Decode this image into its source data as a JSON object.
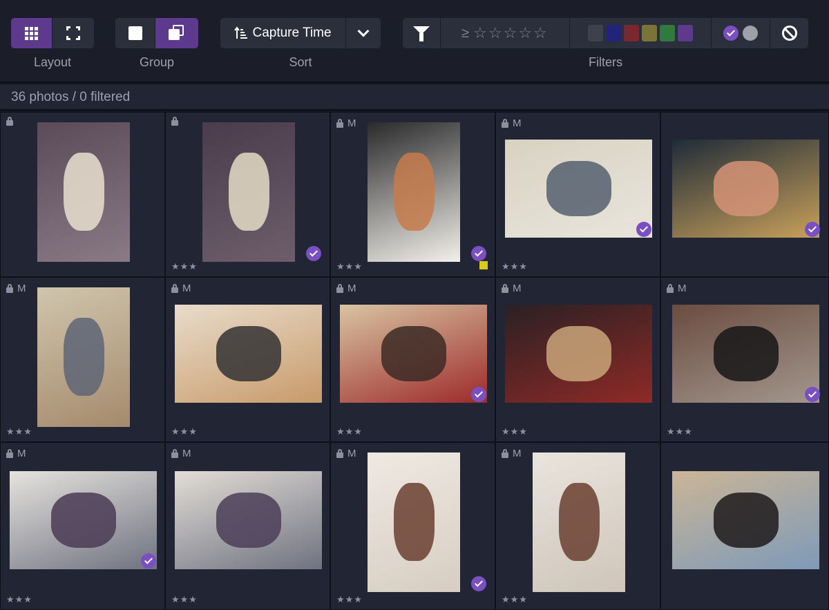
{
  "toolbar": {
    "layout": {
      "label": "Layout",
      "options": [
        "grid-icon",
        "expand-icon"
      ],
      "active": 0
    },
    "group": {
      "label": "Group",
      "options": [
        "single-square-icon",
        "stacked-squares-icon"
      ],
      "active": 1
    },
    "sort": {
      "label": "Sort",
      "value": "Capture Time",
      "icon": "sort-ascending-icon"
    },
    "filters": {
      "label": "Filters",
      "rating_operator": "≥",
      "rating_value": 0,
      "stars_max": 5,
      "color_swatches": [
        "#3d414c",
        "#23237a",
        "#7a2830",
        "#7a7438",
        "#2f7a3c",
        "#5d3a8e"
      ],
      "pick_states": [
        "picked",
        "unpicked"
      ],
      "reject_icon": "no-entry-icon"
    },
    "colors": {
      "active": "#5d3a8e",
      "button": "#2b2f3c",
      "check": "#7a4fc2"
    }
  },
  "status": {
    "text": "36 photos / 0 filtered"
  },
  "photos": [
    {
      "locked": true,
      "mode": "",
      "stars": "",
      "picked": false,
      "label": "",
      "subject": "bouquet-1",
      "orientation": "portrait"
    },
    {
      "locked": true,
      "mode": "",
      "stars": "★★★",
      "picked": true,
      "label": "",
      "subject": "bouquet-2",
      "orientation": "portrait"
    },
    {
      "locked": true,
      "mode": "M",
      "stars": "★★★",
      "picked": true,
      "label": "yellow",
      "subject": "groom-tuxedo",
      "orientation": "portrait"
    },
    {
      "locked": true,
      "mode": "M",
      "stars": "★★★",
      "picked": true,
      "label": "",
      "subject": "bridesmaids-pajamas",
      "orientation": "landscape"
    },
    {
      "locked": false,
      "mode": "",
      "stars": "",
      "picked": true,
      "label": "",
      "subject": "watch-hands",
      "orientation": "landscape"
    },
    {
      "locked": true,
      "mode": "M",
      "stars": "★★★",
      "picked": false,
      "label": "",
      "subject": "girls-plaid",
      "orientation": "portrait"
    },
    {
      "locked": true,
      "mode": "M",
      "stars": "★★★",
      "picked": false,
      "label": "",
      "subject": "groomsmen-table",
      "orientation": "landscape"
    },
    {
      "locked": true,
      "mode": "M",
      "stars": "★★★",
      "picked": true,
      "label": "",
      "subject": "church-aisle",
      "orientation": "landscape"
    },
    {
      "locked": true,
      "mode": "M",
      "stars": "★★★",
      "picked": false,
      "label": "",
      "subject": "church-altar",
      "orientation": "landscape"
    },
    {
      "locked": true,
      "mode": "M",
      "stars": "★★★",
      "picked": true,
      "label": "",
      "subject": "groomsmen-lobby",
      "orientation": "landscape"
    },
    {
      "locked": true,
      "mode": "M",
      "stars": "★★★",
      "picked": true,
      "label": "",
      "subject": "bridesmaids-room-1",
      "orientation": "landscape"
    },
    {
      "locked": true,
      "mode": "M",
      "stars": "★★★",
      "picked": false,
      "label": "",
      "subject": "bridesmaids-room-2",
      "orientation": "landscape"
    },
    {
      "locked": true,
      "mode": "M",
      "stars": "★★★",
      "picked": true,
      "label": "",
      "subject": "bride-veil-1",
      "orientation": "portrait"
    },
    {
      "locked": true,
      "mode": "M",
      "stars": "★★★",
      "picked": false,
      "label": "",
      "subject": "bride-veil-2",
      "orientation": "portrait"
    },
    {
      "locked": false,
      "mode": "",
      "stars": "",
      "picked": false,
      "label": "",
      "subject": "family-tree",
      "orientation": "landscape"
    }
  ]
}
